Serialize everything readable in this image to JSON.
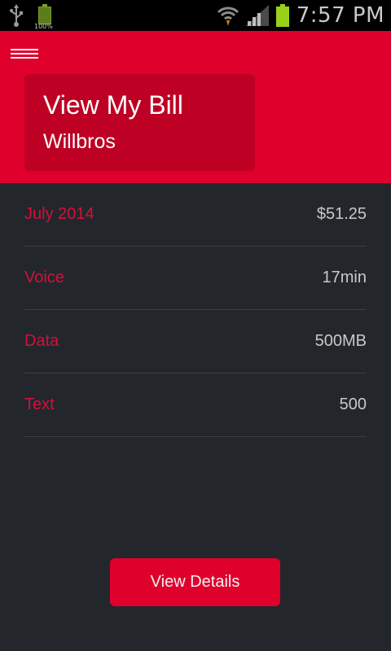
{
  "status_bar": {
    "time": "7:57 PM",
    "battery_small_label": "100%",
    "icons": [
      "usb-icon",
      "battery-full-icon",
      "wifi-icon",
      "signal-icon",
      "battery-icon"
    ]
  },
  "header": {
    "title": "View My Bill",
    "subtitle": "Willbros"
  },
  "bill": {
    "rows": [
      {
        "label": "July 2014",
        "value": "$51.25"
      },
      {
        "label": "Voice",
        "value": "17min"
      },
      {
        "label": "Data",
        "value": "500MB"
      },
      {
        "label": "Text",
        "value": "500"
      }
    ]
  },
  "actions": {
    "details_label": "View Details"
  },
  "colors": {
    "accent": "#e0002c",
    "card": "#bd0023",
    "background": "#23272b",
    "label": "#d4103b"
  }
}
